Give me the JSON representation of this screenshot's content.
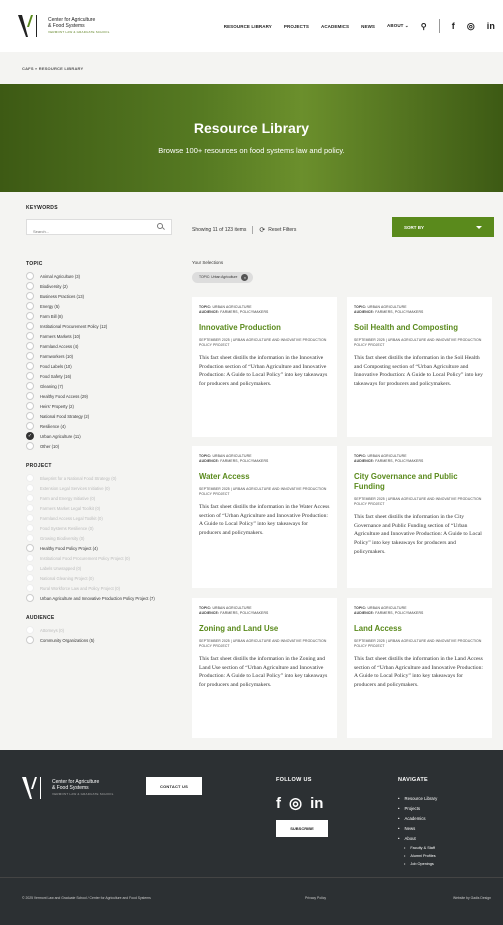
{
  "header": {
    "logo_line1": "Center for Agriculture",
    "logo_line2": "& Food Systems",
    "logo_line3": "VERMONT LAW & GRADUATE SCHOOL",
    "nav": [
      "RESOURCE LIBRARY",
      "PROJECTS",
      "ACADEMICS",
      "NEWS",
      "ABOUT"
    ],
    "about_caret": "⌄",
    "search_glyph": "⚲",
    "social": [
      "f",
      "◎",
      "in"
    ]
  },
  "breadcrumb": "CAFS  »  RESOURCE LIBRARY",
  "hero": {
    "title": "Resource Library",
    "subtitle": "Browse 100+ resources on food systems law and policy."
  },
  "sidebar": {
    "keywords_title": "KEYWORDS",
    "search_placeholder": "Search...",
    "topic_title": "TOPIC",
    "topics": [
      {
        "label": "Animal Agriculture (3)",
        "checked": false
      },
      {
        "label": "Biodiversity (2)",
        "checked": false
      },
      {
        "label": "Business Practices (13)",
        "checked": false
      },
      {
        "label": "Energy (5)",
        "checked": false
      },
      {
        "label": "Farm Bill (8)",
        "checked": false
      },
      {
        "label": "Institutional Procurement Policy (12)",
        "checked": false
      },
      {
        "label": "Farmers Markets (10)",
        "checked": false
      },
      {
        "label": "Farmland Access (4)",
        "checked": false
      },
      {
        "label": "Farmworkers (10)",
        "checked": false
      },
      {
        "label": "Food Labels (10)",
        "checked": false
      },
      {
        "label": "Food Safety (16)",
        "checked": false
      },
      {
        "label": "Gleaning (7)",
        "checked": false
      },
      {
        "label": "Healthy Food Access (29)",
        "checked": false
      },
      {
        "label": "Heirs' Property (2)",
        "checked": false
      },
      {
        "label": "National Food Strategy (2)",
        "checked": false
      },
      {
        "label": "Resilience (4)",
        "checked": false
      },
      {
        "label": "Urban Agriculture (11)",
        "checked": true
      },
      {
        "label": "Other (10)",
        "checked": false
      }
    ],
    "project_title": "PROJECT",
    "projects": [
      {
        "label": "Blueprint for a National Food Strategy (0)",
        "disabled": true
      },
      {
        "label": "Extension Legal Services Initiative (0)",
        "disabled": true
      },
      {
        "label": "Farm and Energy Initiative (0)",
        "disabled": true
      },
      {
        "label": "Farmers Market Legal Toolkit (0)",
        "disabled": true
      },
      {
        "label": "Farmland Access Legal Toolkit (0)",
        "disabled": true
      },
      {
        "label": "Food Systems Resilience (0)",
        "disabled": true
      },
      {
        "label": "Growing Biodiversity (0)",
        "disabled": true
      },
      {
        "label": "Healthy Food Policy Project (4)",
        "disabled": false
      },
      {
        "label": "Institutional Food Procurement Policy Project (0)",
        "disabled": true
      },
      {
        "label": "Labels Unwrapped (0)",
        "disabled": true
      },
      {
        "label": "National Gleaning Project (0)",
        "disabled": true
      },
      {
        "label": "Rural Workforce Law and Policy Project (0)",
        "disabled": true
      },
      {
        "label": "Urban Agriculture and Innovative Production Policy Project (7)",
        "disabled": false
      }
    ],
    "audience_title": "AUDIENCE",
    "audiences": [
      {
        "label": "Attorneys (0)",
        "disabled": true
      },
      {
        "label": "Community Organizations (5)",
        "disabled": false
      }
    ]
  },
  "results": {
    "showing": "Showing 11 of 123 items",
    "reset": "Reset Filters",
    "sort_label": "SORT BY",
    "your_selections": "Your Selections",
    "chip": "TOPIC: Urban Agriculture"
  },
  "cards": [
    {
      "topic": "URBAN AGRICULTURE",
      "audience": "FARMERS, POLICYMAKERS",
      "title": "Innovative Production",
      "date": "SEPTEMBER 2025  |  URBAN AGRICULTURE AND INNOVATIVE PRODUCTION POLICY PROJECT",
      "desc": "This fact sheet distills the information in the Innovative Production section of “Urban Agriculture and Innovative Production: A Guide to Local Policy” into key takeaways for producers and policymakers."
    },
    {
      "topic": "URBAN AGRICULTURE",
      "audience": "FARMERS, POLICYMAKERS",
      "title": "Soil Health and Composting",
      "date": "SEPTEMBER 2025  |  URBAN AGRICULTURE AND INNOVATIVE PRODUCTION POLICY PROJECT",
      "desc": "This fact sheet distills the information in the Soil Health and Composting section of “Urban Agriculture and Innovative Production: A Guide to Local Policy” into key takeaways for producers and policymakers."
    },
    {
      "topic": "URBAN AGRICULTURE",
      "audience": "FARMERS, POLICYMAKERS",
      "title": "Water Access",
      "date": "SEPTEMBER 2025  |  URBAN AGRICULTURE AND INNOVATIVE PRODUCTION POLICY PROJECT",
      "desc": "This fact sheet distills the information in the Water Access section of “Urban Agriculture and Innovative Production: A Guide to Local Policy” into key takeaways for producers and policymakers."
    },
    {
      "topic": "URBAN AGRICULTURE",
      "audience": "FARMERS, POLICYMAKERS",
      "title": "City Governance and Public Funding",
      "date": "SEPTEMBER 2025  |  URBAN AGRICULTURE AND INNOVATIVE PRODUCTION POLICY PROJECT",
      "desc": "This fact sheet distills the information in the City Governance and Public Funding section of “Urban Agriculture and Innovative Production: A Guide to Local Policy” into key takeaways for producers and policymakers."
    },
    {
      "topic": "URBAN AGRICULTURE",
      "audience": "FARMERS, POLICYMAKERS",
      "title": "Zoning and Land Use",
      "date": "SEPTEMBER 2025  |  URBAN AGRICULTURE AND INNOVATIVE PRODUCTION POLICY PROJECT",
      "desc": "This fact sheet distills the information in the Zoning and Land Use section of “Urban Agriculture and Innovative Production: A Guide to Local Policy” into key takeaways for producers and policymakers."
    },
    {
      "topic": "URBAN AGRICULTURE",
      "audience": "FARMERS, POLICYMAKERS",
      "title": "Land Access",
      "date": "SEPTEMBER 2025  |  URBAN AGRICULTURE AND INNOVATIVE PRODUCTION POLICY PROJECT",
      "desc": "This fact sheet distills the information in the Land Access section of “Urban Agriculture and Innovative Production: A Guide to Local Policy” into key takeaways for producers and policymakers."
    }
  ],
  "card_labels": {
    "topic": "TOPIC:",
    "audience": "AUDIENCE:"
  },
  "footer": {
    "contact": "CONTACT US",
    "follow": "FOLLOW US",
    "subscribe": "SUBSCRIBE",
    "navigate": "NAVIGATE",
    "nav": [
      "Resource Library",
      "Projects",
      "Academics",
      "News",
      "About"
    ],
    "about_sub": [
      "Faculty & Staff",
      "Alumni Profiles",
      "Job Openings"
    ],
    "copyright": "© 2025 Vermont Law and Graduate School / Center for Agriculture and Food Systems",
    "privacy": "Privacy Policy",
    "credit": "Website by Gadis Design"
  },
  "colors": {
    "accent": "#5a8a1c",
    "footer_bg": "#2c3033",
    "hero": "#567a22"
  }
}
